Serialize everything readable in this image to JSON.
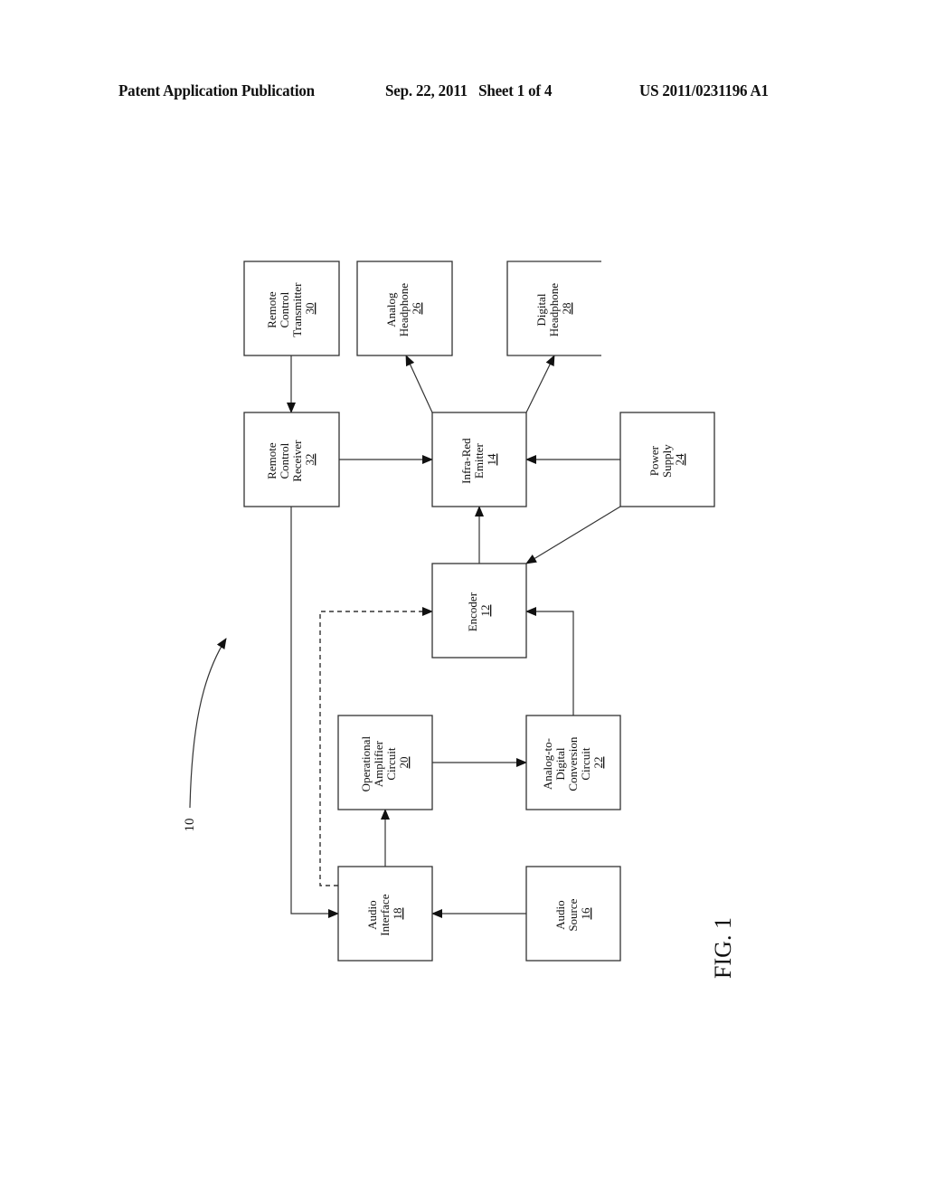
{
  "header": {
    "publication_type": "Patent Application Publication",
    "date_sheet": "Sep. 22, 2011   Sheet 1 of 4",
    "publication_number": "US 2011/0231196 A1"
  },
  "figure": {
    "label": "FIG. 1",
    "reference_numeral": "10"
  },
  "blocks": {
    "remote_control_transmitter": {
      "lines": [
        "Remote",
        "Control",
        "Transmitter"
      ],
      "number": "30"
    },
    "analog_headphone": {
      "lines": [
        "Analog",
        "Headphone"
      ],
      "number": "26"
    },
    "digital_headphone": {
      "lines": [
        "Digital",
        "Headphone"
      ],
      "number": "28"
    },
    "remote_control_receiver": {
      "lines": [
        "Remote",
        "Control",
        "Receiver"
      ],
      "number": "32"
    },
    "infra_red_emitter": {
      "lines": [
        "Infra-Red",
        "Emitter"
      ],
      "number": "14"
    },
    "power_supply": {
      "lines": [
        "Power",
        "Supply"
      ],
      "number": "24"
    },
    "encoder": {
      "lines": [
        "Encoder"
      ],
      "number": "12"
    },
    "operational_amplifier_circuit": {
      "lines": [
        "Operational",
        "Amplifier",
        "Circuit"
      ],
      "number": "20"
    },
    "analog_to_digital_conversion_circuit": {
      "lines": [
        "Analog-to-",
        "Digital",
        "Conversion",
        "Circuit"
      ],
      "number": "22"
    },
    "audio_interface": {
      "lines": [
        "Audio",
        "Interface"
      ],
      "number": "18"
    },
    "audio_source": {
      "lines": [
        "Audio",
        "Source"
      ],
      "number": "16"
    }
  },
  "connections": [
    {
      "from": "remote_control_transmitter",
      "to": "remote_control_receiver",
      "style": "solid",
      "arrow": "none"
    },
    {
      "from": "infra_red_emitter",
      "to": "analog_headphone",
      "style": "solid",
      "arrow": "end"
    },
    {
      "from": "infra_red_emitter",
      "to": "digital_headphone",
      "style": "solid",
      "arrow": "end"
    },
    {
      "from": "remote_control_receiver",
      "to": "infra_red_emitter",
      "style": "solid",
      "arrow": "end"
    },
    {
      "from": "power_supply",
      "to": "infra_red_emitter",
      "style": "solid",
      "arrow": "end"
    },
    {
      "from": "power_supply",
      "to": "encoder",
      "style": "solid",
      "arrow": "end"
    },
    {
      "from": "encoder",
      "to": "infra_red_emitter",
      "style": "solid",
      "arrow": "end"
    },
    {
      "from": "audio_interface",
      "to": "encoder",
      "style": "dashed",
      "arrow": "end"
    },
    {
      "from": "analog_to_digital_conversion_circuit",
      "to": "encoder",
      "style": "solid",
      "arrow": "end"
    },
    {
      "from": "operational_amplifier_circuit",
      "to": "analog_to_digital_conversion_circuit",
      "style": "solid",
      "arrow": "end"
    },
    {
      "from": "audio_interface",
      "to": "operational_amplifier_circuit",
      "style": "solid",
      "arrow": "end"
    },
    {
      "from": "remote_control_receiver",
      "to": "audio_interface",
      "style": "solid",
      "arrow": "end"
    },
    {
      "from": "audio_source",
      "to": "audio_interface",
      "style": "solid",
      "arrow": "end"
    }
  ]
}
